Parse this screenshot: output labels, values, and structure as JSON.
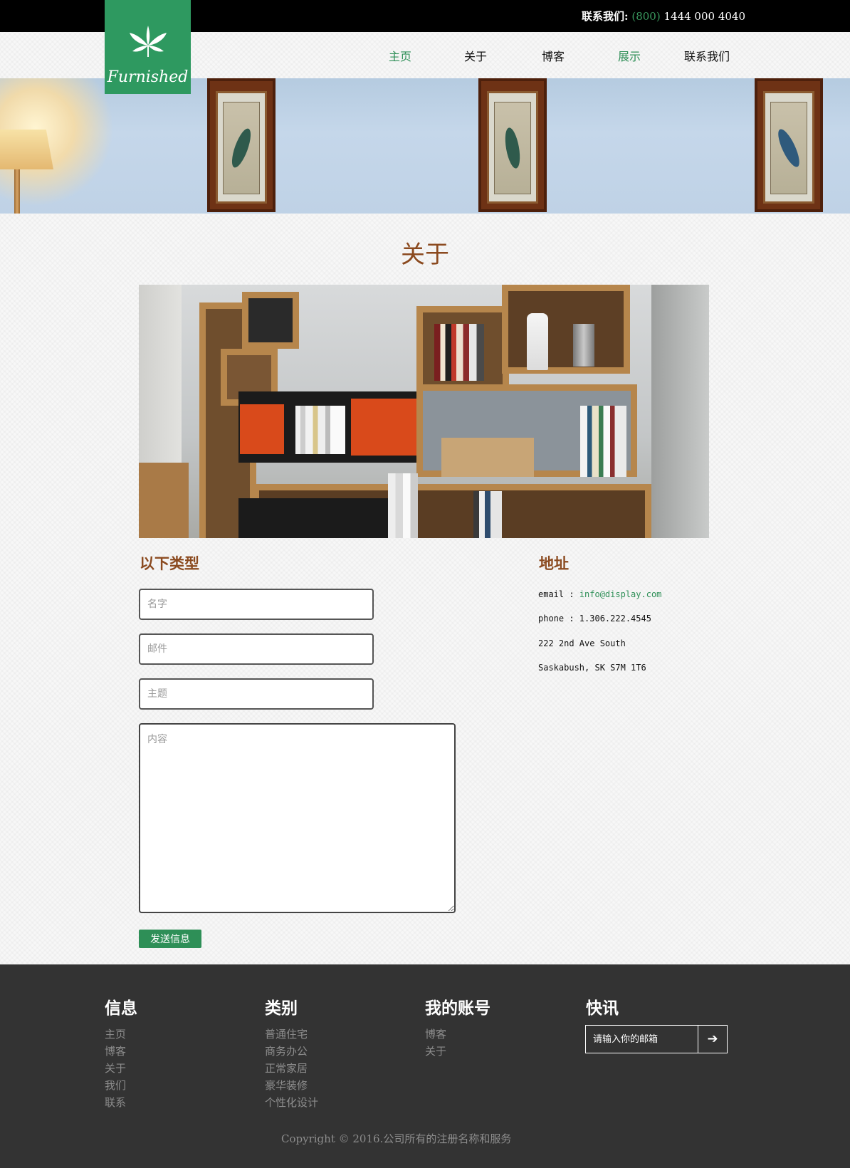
{
  "topbar": {
    "contact_label": "联系我们:",
    "phone_code": "(800)",
    "phone_number": "1444 000 4040"
  },
  "logo": {
    "icon": "leaf-icon",
    "text": "Furnished"
  },
  "nav": {
    "items": [
      {
        "label": "主页",
        "active": true
      },
      {
        "label": "关于",
        "active": false
      },
      {
        "label": "博客",
        "active": false
      },
      {
        "label": "展示",
        "active": true
      },
      {
        "label": "联系我们",
        "active": false
      }
    ]
  },
  "page": {
    "title": "关于"
  },
  "form": {
    "heading": "以下类型",
    "name_placeholder": "名字",
    "email_placeholder": "邮件",
    "subject_placeholder": "主题",
    "message_placeholder": "内容",
    "send_label": "发送信息"
  },
  "address": {
    "heading": "地址",
    "email_label": "email :",
    "email_value": "info@display.com",
    "phone_line": "phone : 1.306.222.4545",
    "street_line": "222 2nd Ave South",
    "city_line": "Saskabush, SK S7M 1T6"
  },
  "footer": {
    "columns": [
      {
        "title": "信息",
        "links": [
          "主页",
          "博客",
          "关于",
          "我们",
          "联系"
        ]
      },
      {
        "title": "类别",
        "links": [
          "普通住宅",
          "商务办公",
          "正常家居",
          "豪华装修",
          "个性化设计"
        ]
      },
      {
        "title": "我的账号",
        "links": [
          "博客",
          "关于"
        ]
      }
    ],
    "newsletter": {
      "title": "快讯",
      "placeholder": "请输入你的邮箱",
      "submit_icon": "arrow-right-icon"
    },
    "copyright": "Copyright © 2016.公司所有的注册名称和服务"
  },
  "colors": {
    "accent_green": "#2e9960",
    "heading_brown": "#8b4a1f",
    "footer_bg": "#333333"
  }
}
